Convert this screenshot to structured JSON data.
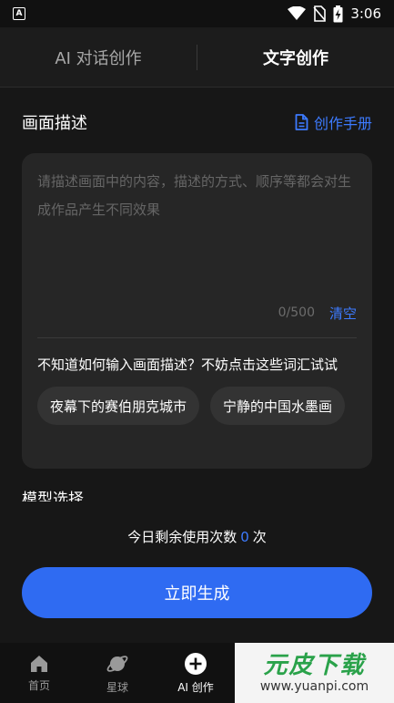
{
  "status_bar": {
    "time": "3:06",
    "icons": [
      "notification-a-icon",
      "wifi-icon",
      "no-sim-icon",
      "battery-charging-icon"
    ]
  },
  "tabs": [
    {
      "label": "AI 对话创作",
      "active": false
    },
    {
      "label": "文字创作",
      "active": true
    }
  ],
  "description": {
    "title": "画面描述",
    "manual_link": "创作手册",
    "placeholder": "请描述画面中的内容，描述的方式、顺序等都会对生成作品产生不同效果",
    "value": "",
    "counter": "0/500",
    "clear_label": "清空",
    "hint": "不知道如何输入画面描述？不妨点击这些词汇试试",
    "suggestions": [
      "夜幕下的赛伯朋克城市",
      "宁静的中国水墨画"
    ]
  },
  "model": {
    "title": "模型选择"
  },
  "usage": {
    "prefix": "今日剩余使用次数",
    "count": "0",
    "suffix": "次"
  },
  "generate_button": "立即生成",
  "bottom_nav": [
    {
      "label": "首页",
      "icon": "home-icon",
      "active": false
    },
    {
      "label": "星球",
      "icon": "planet-icon",
      "active": false
    },
    {
      "label": "AI 创作",
      "icon": "plus-circle-icon",
      "active": true
    }
  ],
  "watermark": {
    "title": "元皮下载",
    "url": "www.yuanpi.com"
  },
  "colors": {
    "accent": "#3d7bff",
    "button": "#2f6bf2",
    "background": "#171717",
    "card": "#262626"
  }
}
